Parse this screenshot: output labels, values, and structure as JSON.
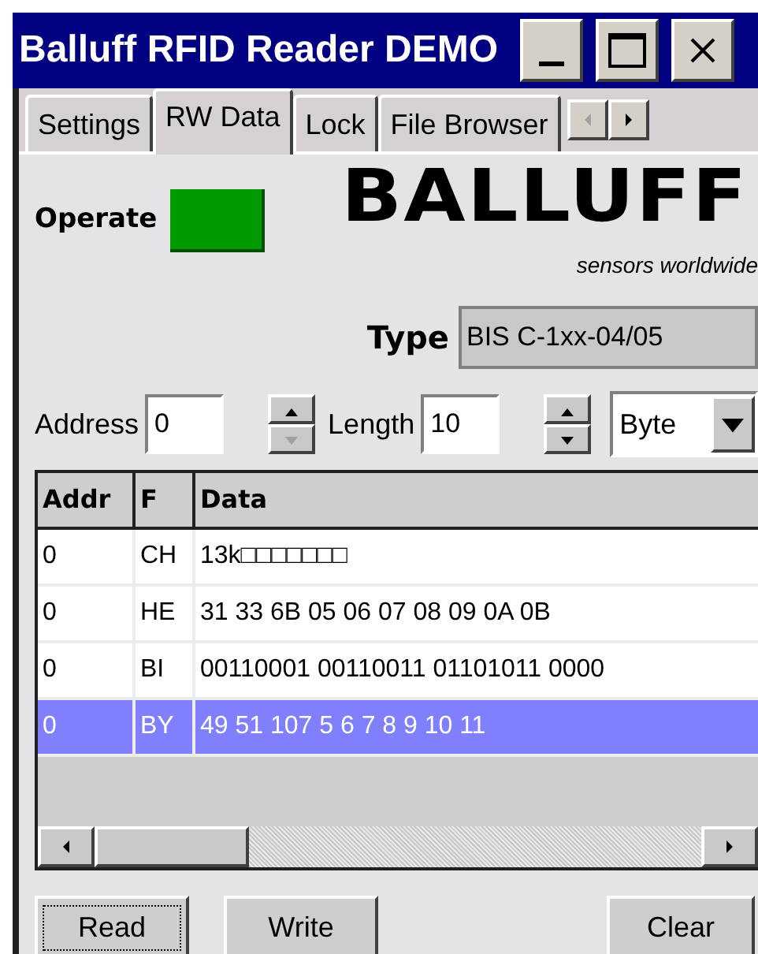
{
  "window": {
    "title": "Balluff RFID Reader DEMO"
  },
  "tabs": [
    {
      "label": "Settings",
      "selected": false
    },
    {
      "label": "RW Data",
      "selected": true
    },
    {
      "label": "Lock",
      "selected": false
    },
    {
      "label": "File Browser",
      "selected": false
    }
  ],
  "operate": {
    "label": "Operate",
    "on": true
  },
  "logo": {
    "name": "BALLUFF",
    "tagline": "sensors worldwide"
  },
  "type": {
    "label": "Type",
    "value": "BIS C-1xx-04/05"
  },
  "address": {
    "label": "Address",
    "value": "0",
    "down_disabled": true
  },
  "length": {
    "label": "Length",
    "value": "10",
    "down_disabled": false
  },
  "format_select": {
    "value": "Byte"
  },
  "table": {
    "columns": [
      "Addr",
      "F",
      "Data"
    ],
    "rows": [
      {
        "cells": [
          "0",
          "CH",
          "13k□□□□□□□"
        ],
        "selected": false
      },
      {
        "cells": [
          "0",
          "HE",
          "31 33 6B 05 06 07 08 09 0A 0B"
        ],
        "selected": false
      },
      {
        "cells": [
          "0",
          "BI",
          "00110001 00110011 01101011 0000"
        ],
        "selected": false
      },
      {
        "cells": [
          "0",
          "BY",
          "49 51 107 5 6 7 8 9 10 11"
        ],
        "selected": true
      }
    ]
  },
  "buttons": [
    {
      "label": "Read",
      "focused": true
    },
    {
      "label": "Write",
      "focused": false
    },
    {
      "label": "Clear",
      "focused": false
    }
  ]
}
